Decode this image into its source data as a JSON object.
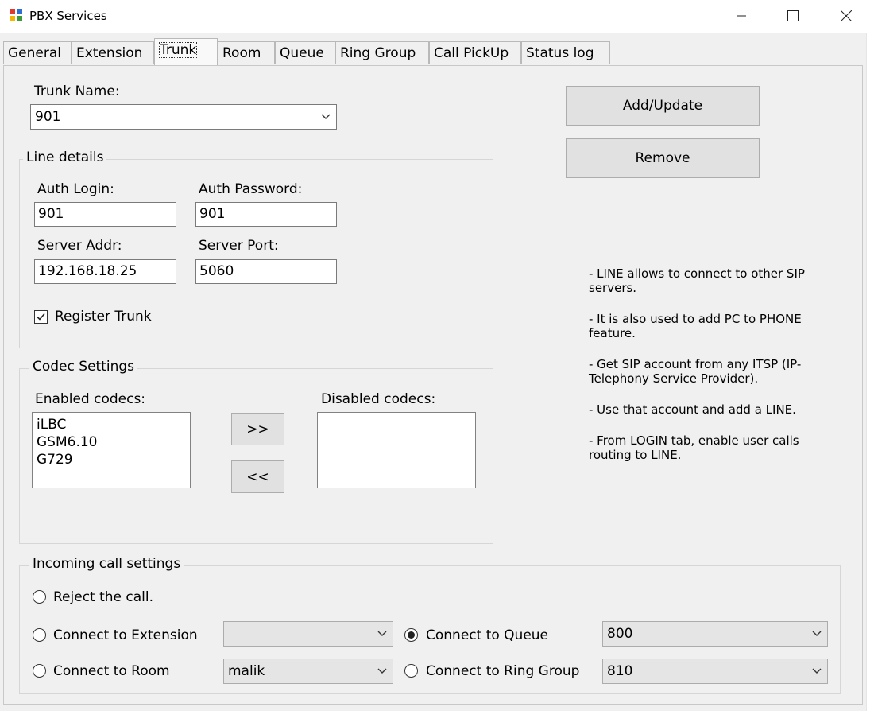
{
  "window": {
    "title": "PBX Services"
  },
  "tabs": [
    {
      "label": "General"
    },
    {
      "label": "Extension"
    },
    {
      "label": "Trunk"
    },
    {
      "label": "Room"
    },
    {
      "label": "Queue"
    },
    {
      "label": "Ring Group"
    },
    {
      "label": "Call PickUp"
    },
    {
      "label": "Status log"
    }
  ],
  "active_tab": "Trunk",
  "trunk": {
    "label": "Trunk Name:",
    "value": "901"
  },
  "buttons": {
    "add_update": "Add/Update",
    "remove": "Remove",
    "enable": ">>",
    "disable": "<<"
  },
  "line_details": {
    "legend": "Line details",
    "auth_login_label": "Auth Login:",
    "auth_login": "901",
    "auth_password_label": "Auth Password:",
    "auth_password": "901",
    "server_addr_label": "Server Addr:",
    "server_addr": "192.168.18.25",
    "server_port_label": "Server Port:",
    "server_port": "5060",
    "register_label": "Register Trunk",
    "register_checked": true
  },
  "codecs": {
    "legend": "Codec Settings",
    "enabled_label": "Enabled codecs:",
    "disabled_label": "Disabled codecs:",
    "enabled": [
      "iLBC",
      "GSM6.10",
      "G729"
    ],
    "disabled": []
  },
  "notes": [
    "- LINE allows to connect to other SIP servers.",
    "- It is also used to add PC to PHONE feature.",
    "- Get SIP account from any ITSP (IP-Telephony Service Provider).",
    "- Use that account and add a LINE.",
    "- From LOGIN tab, enable user calls routing to LINE."
  ],
  "incoming": {
    "legend": "Incoming call settings",
    "reject_label": "Reject the call.",
    "extension_label": "Connect to Extension",
    "extension_value": "",
    "room_label": "Connect to Room",
    "room_value": "malik",
    "queue_label": "Connect to Queue",
    "queue_value": "800",
    "ringgroup_label": "Connect to Ring Group",
    "ringgroup_value": "810",
    "selected": "queue"
  }
}
